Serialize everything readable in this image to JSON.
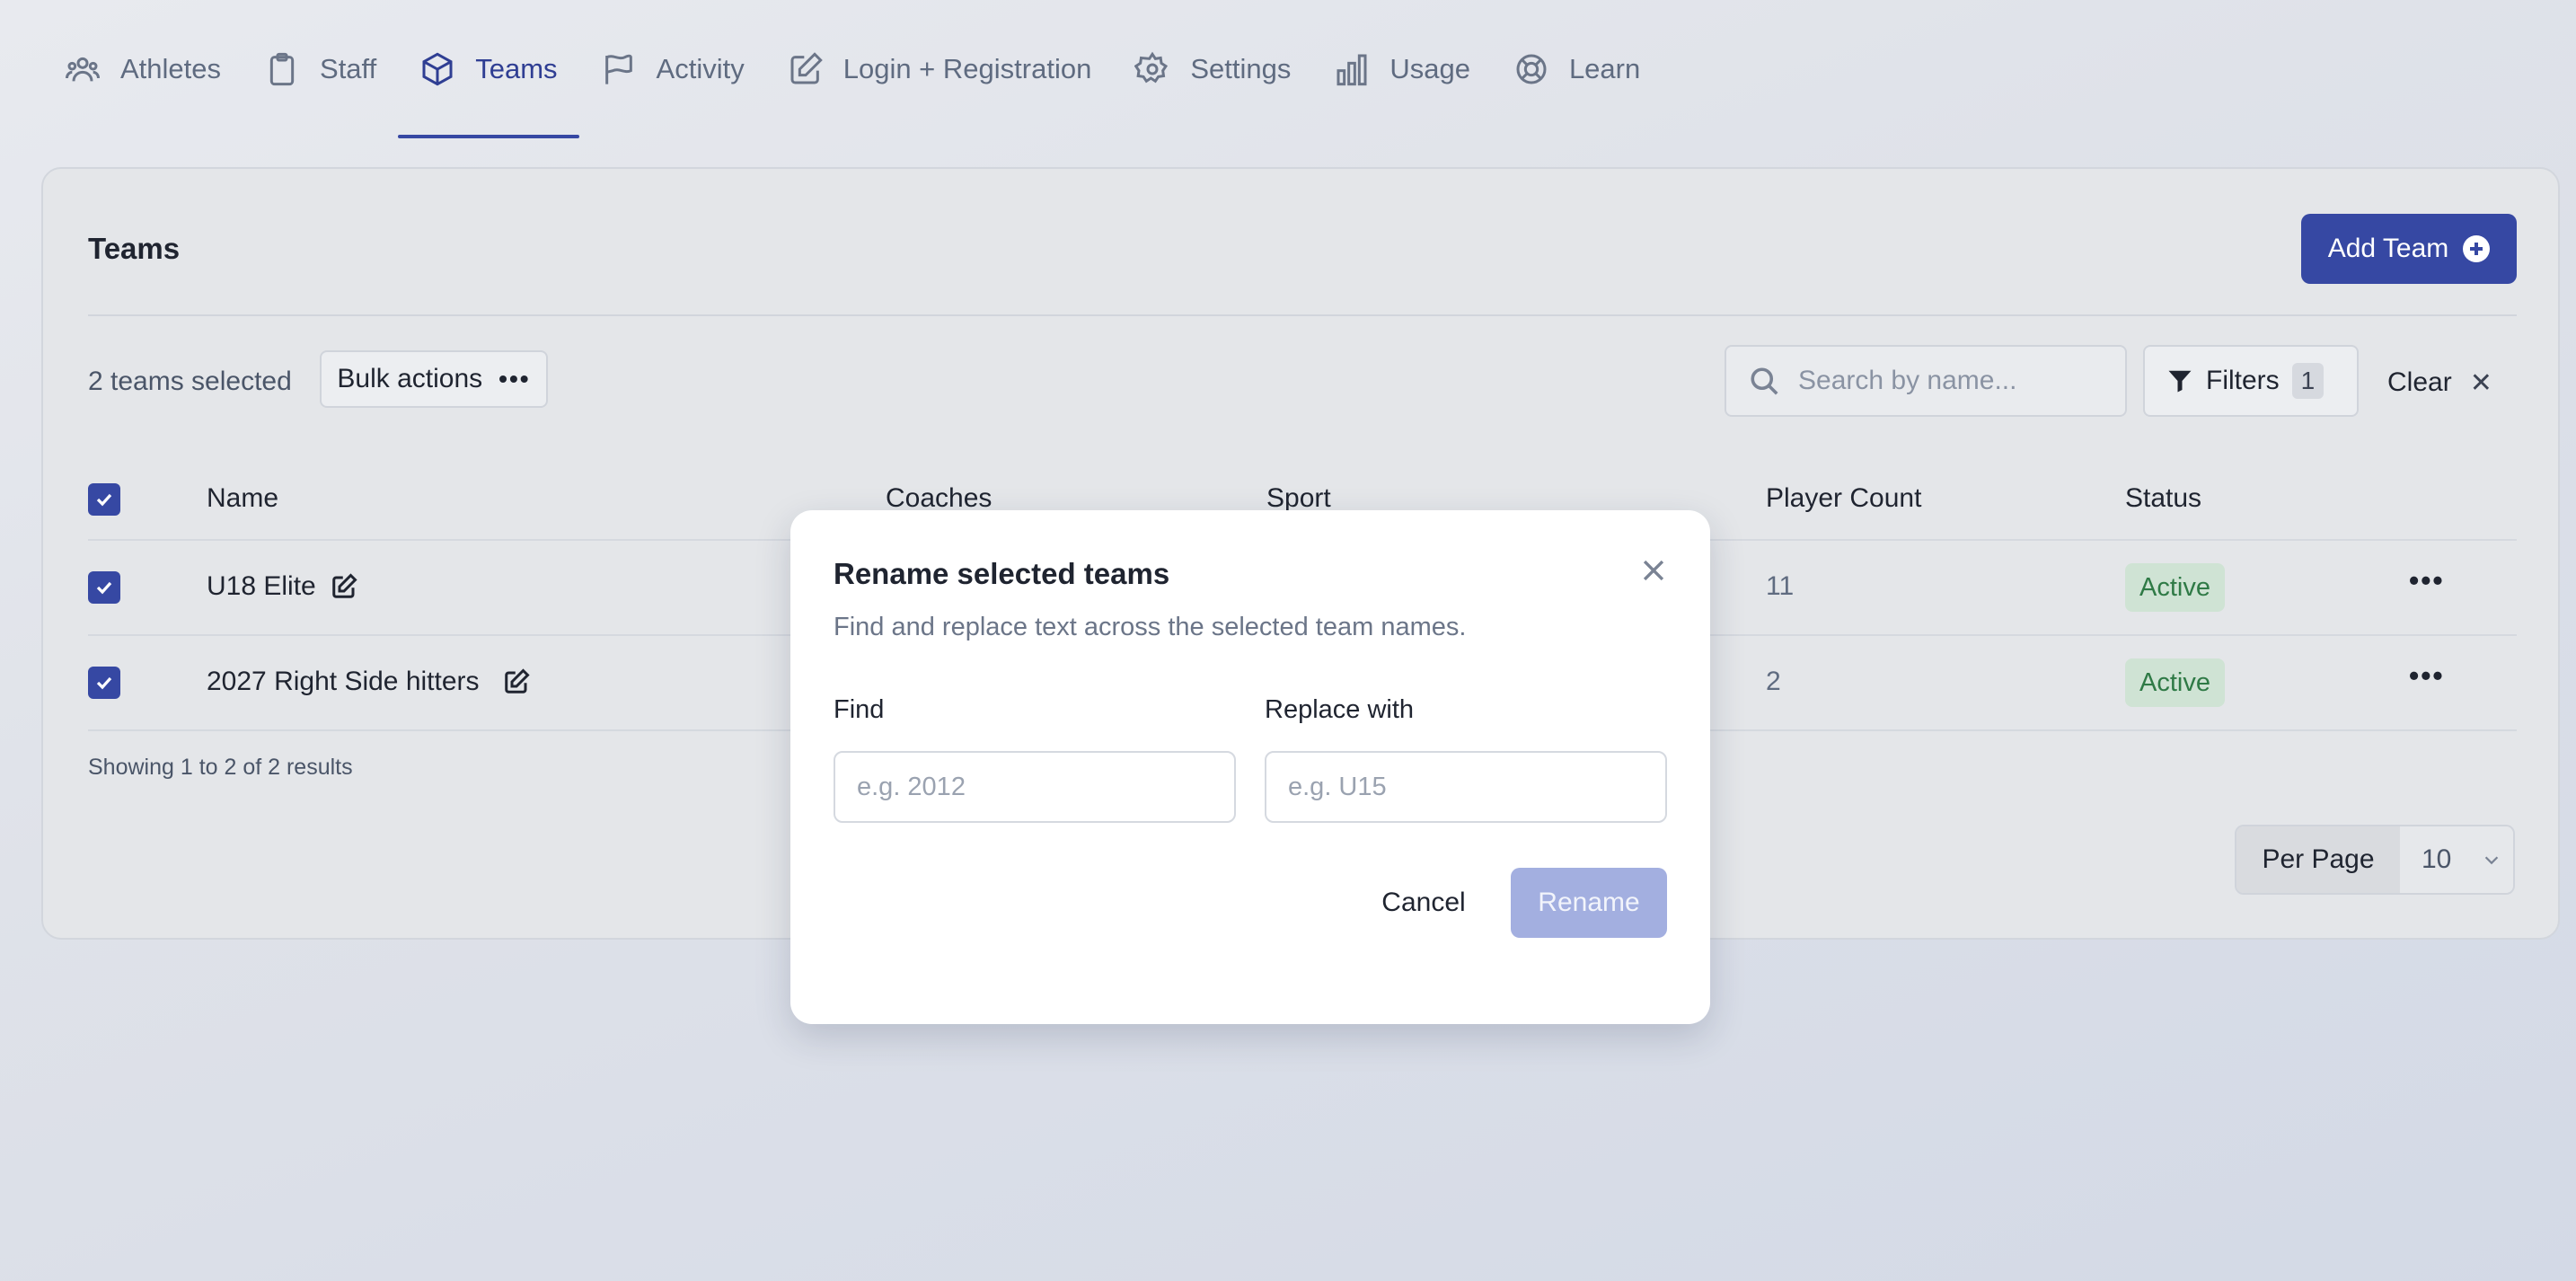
{
  "nav": {
    "items": [
      {
        "label": "Athletes",
        "icon": "users-icon",
        "active": false
      },
      {
        "label": "Staff",
        "icon": "clipboard-icon",
        "active": false
      },
      {
        "label": "Teams",
        "icon": "cube-icon",
        "active": true
      },
      {
        "label": "Activity",
        "icon": "flag-icon",
        "active": false
      },
      {
        "label": "Login + Registration",
        "icon": "pencil-square-icon",
        "active": false
      },
      {
        "label": "Settings",
        "icon": "gear-icon",
        "active": false
      },
      {
        "label": "Usage",
        "icon": "bar-chart-icon",
        "active": false
      },
      {
        "label": "Learn",
        "icon": "lifebuoy-icon",
        "active": false
      }
    ]
  },
  "card": {
    "title": "Teams",
    "add_button": "Add Team"
  },
  "toolbar": {
    "selected_text": "2 teams selected",
    "bulk_actions": "Bulk actions",
    "search_placeholder": "Search by name...",
    "filters_label": "Filters",
    "filters_count": "1",
    "clear_label": "Clear"
  },
  "table": {
    "columns": [
      "Name",
      "Coaches",
      "Sport",
      "Player Count",
      "Status"
    ],
    "rows": [
      {
        "name": "U18 Elite",
        "player_count": "11",
        "status": "Active",
        "checked": true
      },
      {
        "name": "2027 Right Side hitters",
        "player_count": "2",
        "status": "Active",
        "checked": true
      }
    ],
    "showing": "Showing 1 to 2 of 2 results"
  },
  "pagination": {
    "per_page_label": "Per Page",
    "per_page_value": "10"
  },
  "modal": {
    "title": "Rename selected teams",
    "description": "Find and replace text across the selected team names.",
    "find_label": "Find",
    "find_placeholder": "e.g. 2012",
    "replace_label": "Replace with",
    "replace_placeholder": "e.g. U15",
    "cancel": "Cancel",
    "rename": "Rename"
  },
  "colors": {
    "accent": "#3648a3",
    "badge_bg": "#cfe3d4",
    "badge_text": "#2f7a46",
    "rename_disabled": "#a3afe0"
  }
}
